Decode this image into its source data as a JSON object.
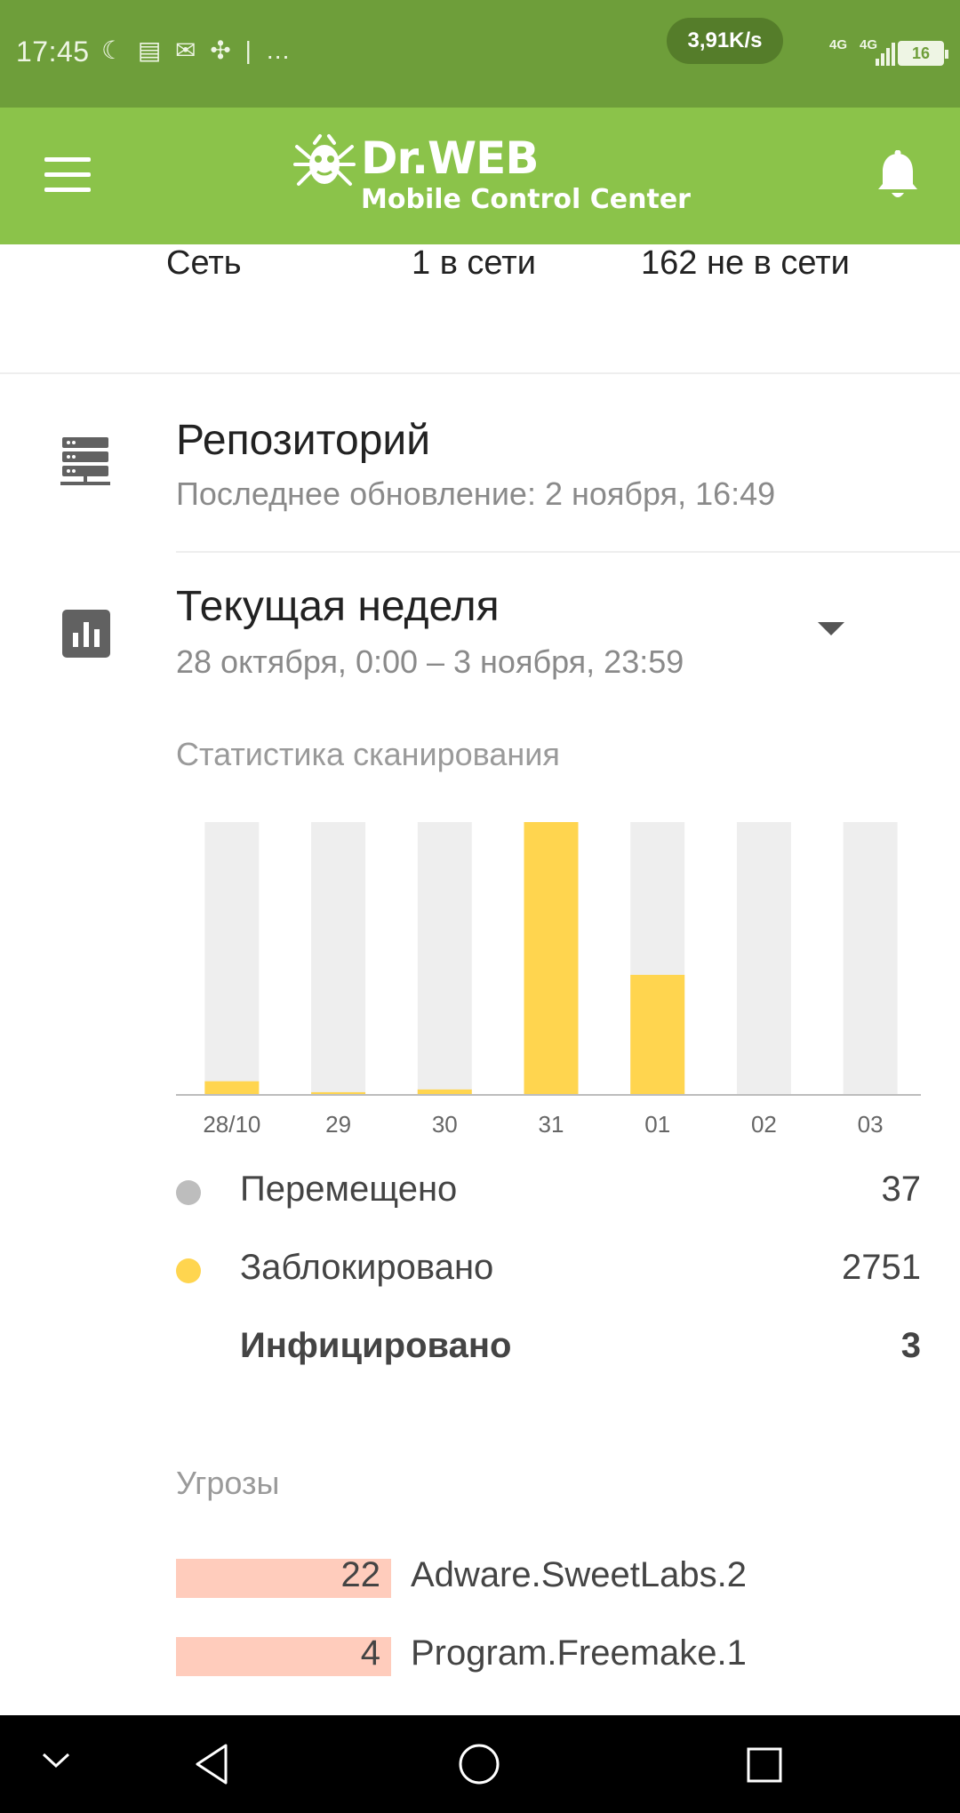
{
  "status_bar": {
    "time": "17:45",
    "notification_icons": "☾ ▤ ✉ ✣ | …",
    "speed": "3,91K/s",
    "net1": "4G",
    "net2": "4G",
    "battery": "16"
  },
  "app_bar": {
    "logo_title": "Dr.WEB",
    "logo_subtitle": "Mobile Control Center",
    "menu_icon": "hamburger-icon",
    "notification_icon": "bell-icon"
  },
  "network": {
    "label": "Сеть",
    "online": "1 в сети",
    "offline": "162 не в сети"
  },
  "repository": {
    "icon": "server-icon",
    "title": "Репозиторий",
    "subtitle": "Последнее обновление: 2 ноября, 16:49"
  },
  "period": {
    "icon": "bar-chart-icon",
    "title": "Текущая неделя",
    "range": "28 октября, 0:00 – 3 ноября, 23:59"
  },
  "scan_stats": {
    "heading": "Статистика сканирования",
    "legend": [
      {
        "label": "Перемещено",
        "value": "37",
        "color": "#bdbdbd"
      },
      {
        "label": "Заблокировано",
        "value": "2751",
        "color": "#ffd54f"
      },
      {
        "label": "Инфицировано",
        "value": "3",
        "color": ""
      }
    ]
  },
  "chart_data": {
    "type": "bar",
    "categories": [
      "28/10",
      "29",
      "30",
      "31",
      "01",
      "02",
      "03"
    ],
    "series": [
      {
        "name": "Заблокировано",
        "values": [
          0.05,
          0.01,
          0.02,
          1.0,
          0.44,
          0.0,
          0.0
        ],
        "color": "#ffd54f"
      }
    ],
    "background_color": "#eeeeee",
    "ylim": [
      0,
      1
    ],
    "grid": false
  },
  "threats": {
    "heading": "Угрозы",
    "items": [
      {
        "count": "22",
        "name": "Adware.SweetLabs.2"
      },
      {
        "count": "4",
        "name": "Program.Freemake.1"
      }
    ]
  },
  "nav_bar": {
    "icons": [
      "chevron-down-icon",
      "back-icon",
      "home-icon",
      "recents-icon"
    ]
  }
}
